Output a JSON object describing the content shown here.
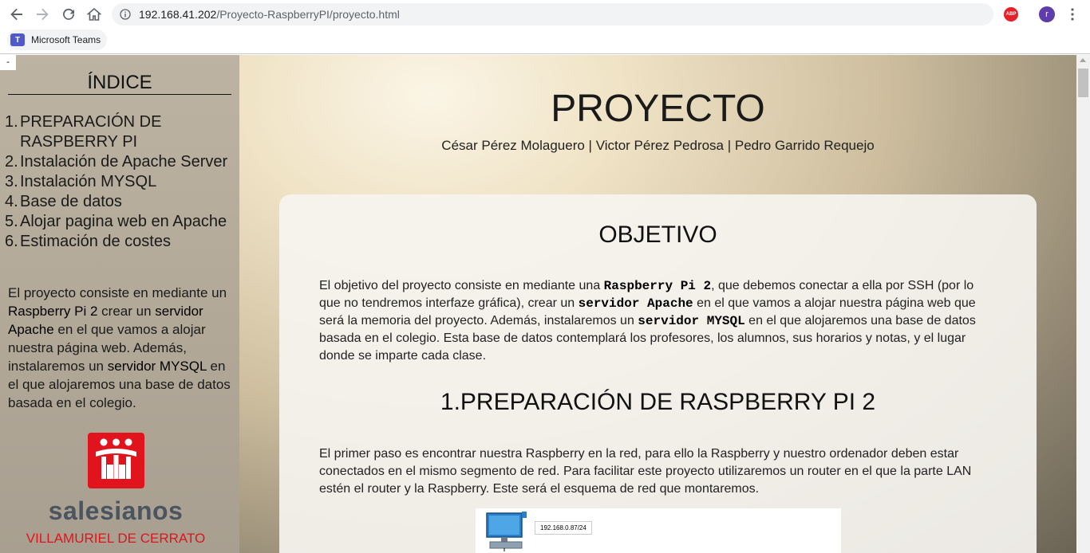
{
  "browser": {
    "url_host": "192.168.41.202",
    "url_path": "/Proyecto-RaspberryPI/proyecto.html",
    "bookmark_label": "Microsoft Teams",
    "bookmark_icon": "T",
    "abp_label": "ABP",
    "profile_initial": "r"
  },
  "sidebar": {
    "toggle": "-",
    "title": "ÍNDICE",
    "items": [
      {
        "num": "1.",
        "label": "PREPARACIÓN DE RASPBERRY PI"
      },
      {
        "num": "2.",
        "label": "Instalación de Apache Server"
      },
      {
        "num": "3.",
        "label": "Instalación MYSQL"
      },
      {
        "num": "4.",
        "label": "Base de datos"
      },
      {
        "num": "5.",
        "label": "Alojar pagina web en Apache"
      },
      {
        "num": "6.",
        "label": "Estimación de costes"
      }
    ],
    "desc": {
      "p1": "El proyecto consiste en mediante un ",
      "h1": "Raspberry Pi 2",
      "p2": " crear un ",
      "h2": "servidor Apache",
      "p3": " en el que vamos a alojar nuestra página web. Además, instalaremos un ",
      "h3": "servidor MYSQL",
      "p4": " en el que alojaremos una base de datos basada en el colegio."
    },
    "logo_name": "salesianos",
    "logo_place": "VILLAMURIEL DE CERRATO"
  },
  "main": {
    "title": "PROYECTO",
    "authors": "César Pérez Molaguero | Victor Pérez Pedrosa | Pedro Garrido Requejo",
    "objective_title": "OBJETIVO",
    "objective": {
      "t1": "El objetivo del proyecto consiste en mediante una ",
      "m1": "Raspberry Pi 2",
      "t2": ", que debemos conectar a ella por SSH (por lo que no tendremos interfaze gráfica), crear un ",
      "m2": "servidor Apache",
      "t3": " en el que vamos a alojar nuestra página web que será la memoria del proyecto. Además, instalaremos un ",
      "m3": "servidor MYSQL",
      "t4": " en el que alojaremos una base de datos basada en el colegio. Esta base de datos contemplará los profesores, los alumnos, sus horarios y notas, y el lugar donde se imparte cada clase."
    },
    "section1_title": "1.PREPARACIÓN DE RASPBERRY PI 2",
    "section1_text": "El primer paso es encontrar nuestra Raspberry en la red, para ello la Raspberry y nuestro ordenador deben estar conectados en el mismo segmento de red. Para facilitar este proyecto utilizaremos un router en el que la parte LAN estén el router y la Raspberry. Este será el esquema de red que montaremos.",
    "diagram_ip": "192.168.0.87/24"
  }
}
